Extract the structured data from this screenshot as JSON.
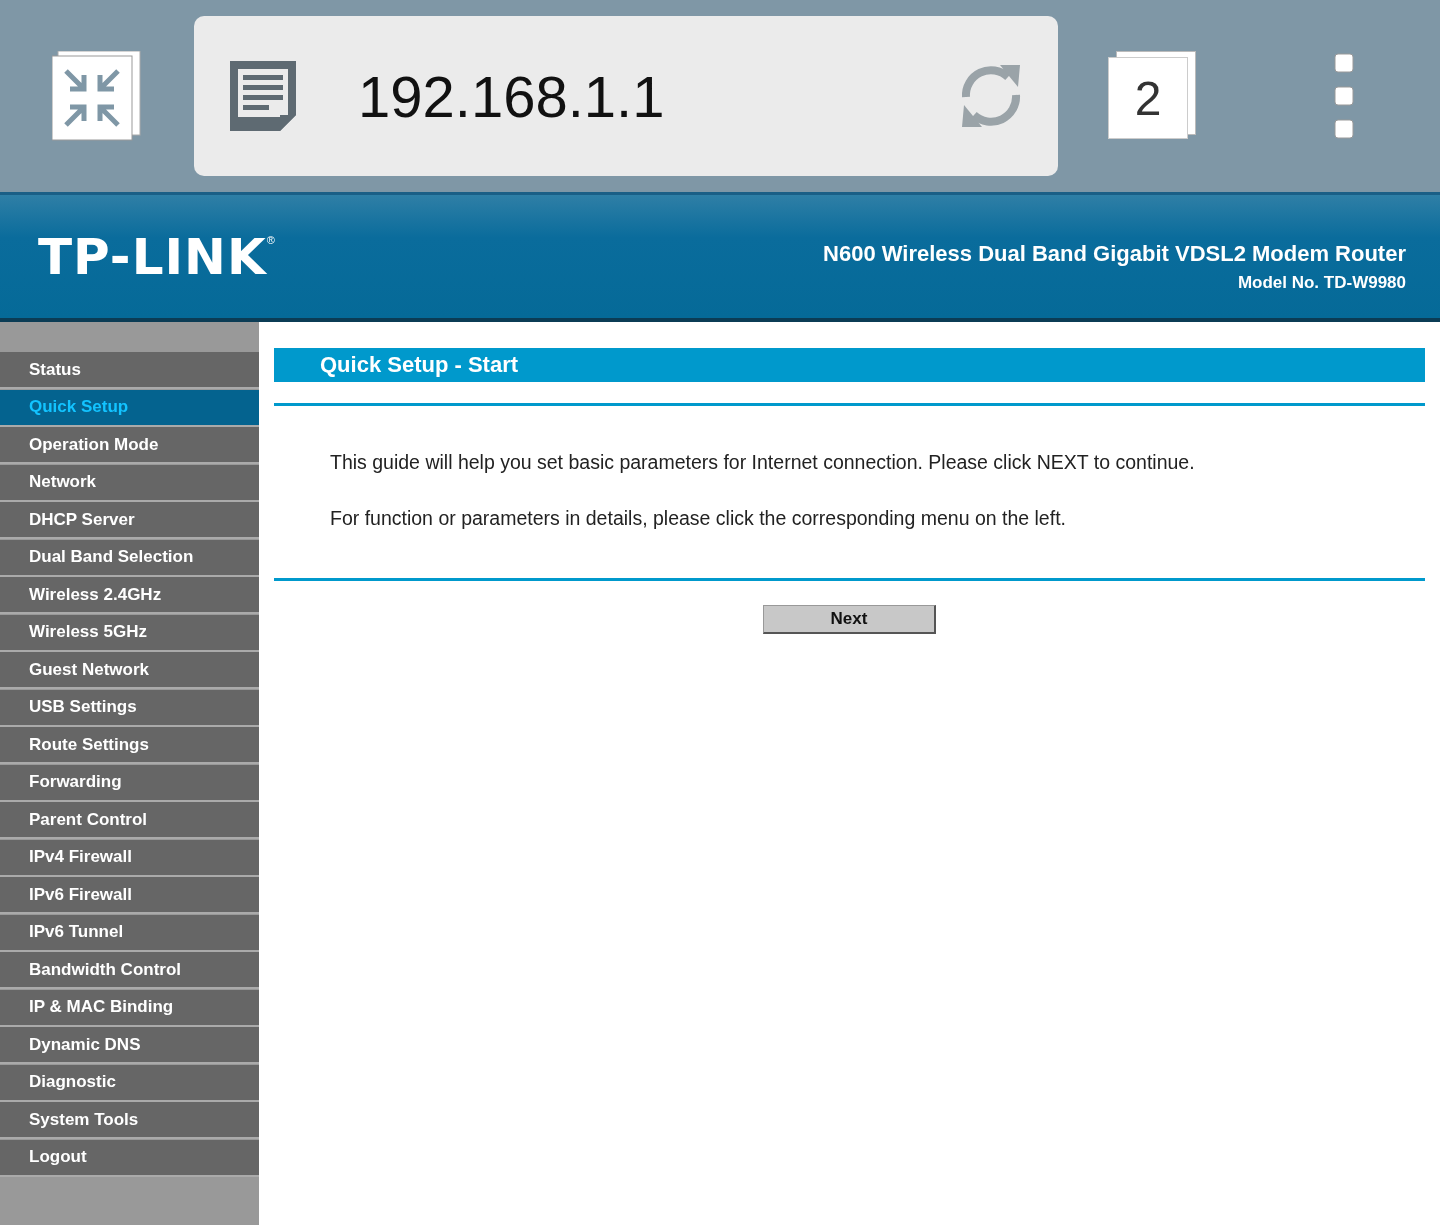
{
  "browser": {
    "url": "192.168.1.1",
    "tab_count": "2"
  },
  "header": {
    "logo": "TP-LINK",
    "logo_mark": "®",
    "product": "N600 Wireless Dual Band Gigabit VDSL2 Modem Router",
    "model": "Model No. TD-W9980"
  },
  "sidebar": {
    "items": [
      {
        "label": "Status",
        "selected": false
      },
      {
        "label": "Quick Setup",
        "selected": true
      },
      {
        "label": "Operation Mode",
        "selected": false
      },
      {
        "label": "Network",
        "selected": false
      },
      {
        "label": "DHCP Server",
        "selected": false
      },
      {
        "label": "Dual Band Selection",
        "selected": false
      },
      {
        "label": "Wireless 2.4GHz",
        "selected": false
      },
      {
        "label": "Wireless 5GHz",
        "selected": false
      },
      {
        "label": "Guest Network",
        "selected": false
      },
      {
        "label": "USB Settings",
        "selected": false
      },
      {
        "label": "Route Settings",
        "selected": false
      },
      {
        "label": "Forwarding",
        "selected": false
      },
      {
        "label": "Parent Control",
        "selected": false
      },
      {
        "label": "IPv4 Firewall",
        "selected": false
      },
      {
        "label": "IPv6 Firewall",
        "selected": false
      },
      {
        "label": "IPv6 Tunnel",
        "selected": false
      },
      {
        "label": "Bandwidth Control",
        "selected": false
      },
      {
        "label": "IP & MAC Binding",
        "selected": false
      },
      {
        "label": "Dynamic DNS",
        "selected": false
      },
      {
        "label": "Diagnostic",
        "selected": false
      },
      {
        "label": "System Tools",
        "selected": false
      },
      {
        "label": "Logout",
        "selected": false
      }
    ]
  },
  "content": {
    "title": "Quick Setup - Start",
    "paragraphs": [
      "This guide will help you set basic parameters for Internet connection. Please click NEXT to continue.",
      "For function or parameters in details, please click the corresponding menu on the left."
    ],
    "button": "Next"
  }
}
